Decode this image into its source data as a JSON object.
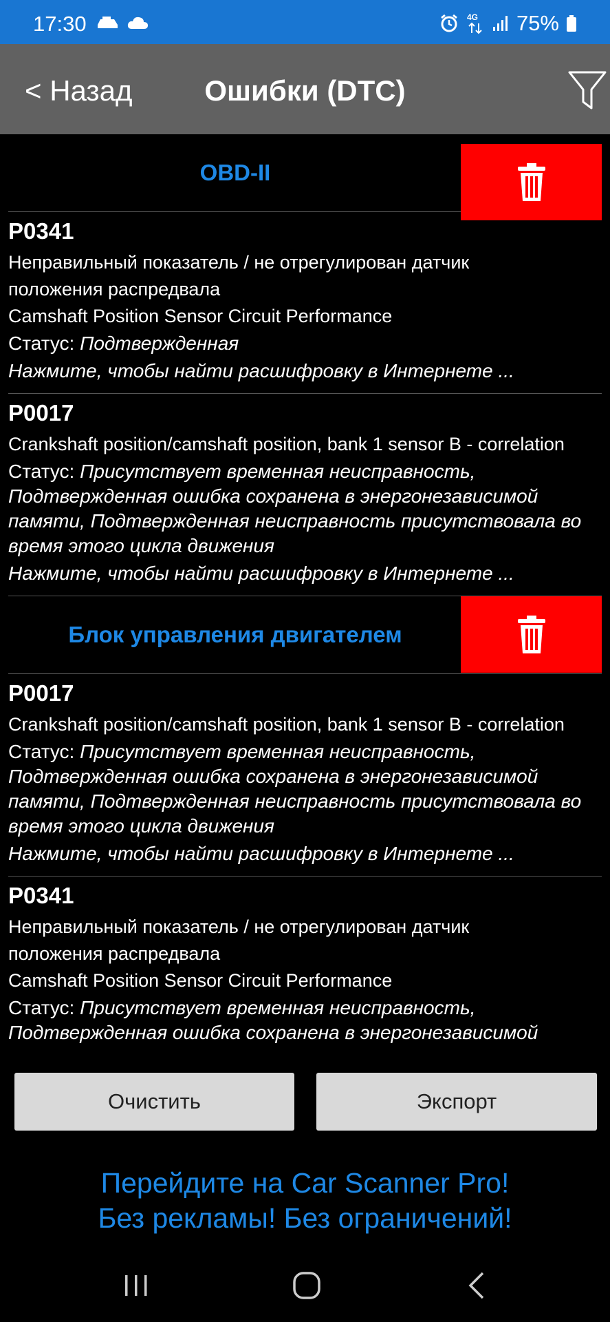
{
  "status_bar": {
    "time": "17:30",
    "network": "4G",
    "battery": "75%",
    "icons": [
      "car-icon",
      "cloud-icon",
      "alarm-icon",
      "network-arrows-icon",
      "signal-icon",
      "battery-icon"
    ]
  },
  "header": {
    "back_label": "< Назад",
    "title": "Ошибки (DTC)",
    "filter_icon": "filter-icon"
  },
  "sections": [
    {
      "title": "OBD-II",
      "items": [
        {
          "code": "P0341",
          "desc_lines": [
            "Неправильный показатель / не отрегулирован датчик",
            "положения распредвала"
          ],
          "desc_en": "Camshaft Position Sensor Circuit Performance",
          "status_label": "Статус: ",
          "status_value": "Подтвержденная",
          "hint": "Нажмите, чтобы найти расшифровку в Интернете ..."
        },
        {
          "code": "P0017",
          "desc_lines": [],
          "desc_en": "Crankshaft position/camshaft position, bank 1 sensor B - correlation",
          "status_label": "Статус: ",
          "status_value": "Присутствует временная неисправность, Подтвержденная ошибка сохранена в энергонезависимой памяти, Подтвержденная неисправность присутствовала во время этого цикла движения",
          "hint": "Нажмите, чтобы найти расшифровку в Интернете ..."
        }
      ]
    },
    {
      "title": "Блок управления двигателем",
      "items": [
        {
          "code": "P0017",
          "desc_lines": [],
          "desc_en": "Crankshaft position/camshaft position, bank 1 sensor B - correlation",
          "status_label": "Статус: ",
          "status_value": "Присутствует временная неисправность, Подтвержденная ошибка сохранена в энергонезависимой памяти, Подтвержденная неисправность присутствовала во время этого цикла движения",
          "hint": "Нажмите, чтобы найти расшифровку в Интернете ..."
        },
        {
          "code": "P0341",
          "desc_lines": [
            "Неправильный показатель / не отрегулирован датчик",
            "положения распредвала"
          ],
          "desc_en": "Camshaft Position Sensor Circuit Performance",
          "status_label": "Статус: ",
          "status_value": "Присутствует временная неисправность, Подтвержденная ошибка сохранена в энергонезависимой памяти, Подтвержденная ошибка присутствует во время",
          "hint": ""
        }
      ]
    }
  ],
  "buttons": {
    "clear": "Очистить",
    "export": "Экспорт"
  },
  "promo": {
    "line1": "Перейдите на Car Scanner Pro!",
    "line2": "Без рекламы! Без ограничений!"
  },
  "colors": {
    "status_bar": "#1976d2",
    "header": "#616161",
    "accent": "#1e88e5",
    "delete": "#ff0000",
    "button": "#d9d9d9"
  }
}
